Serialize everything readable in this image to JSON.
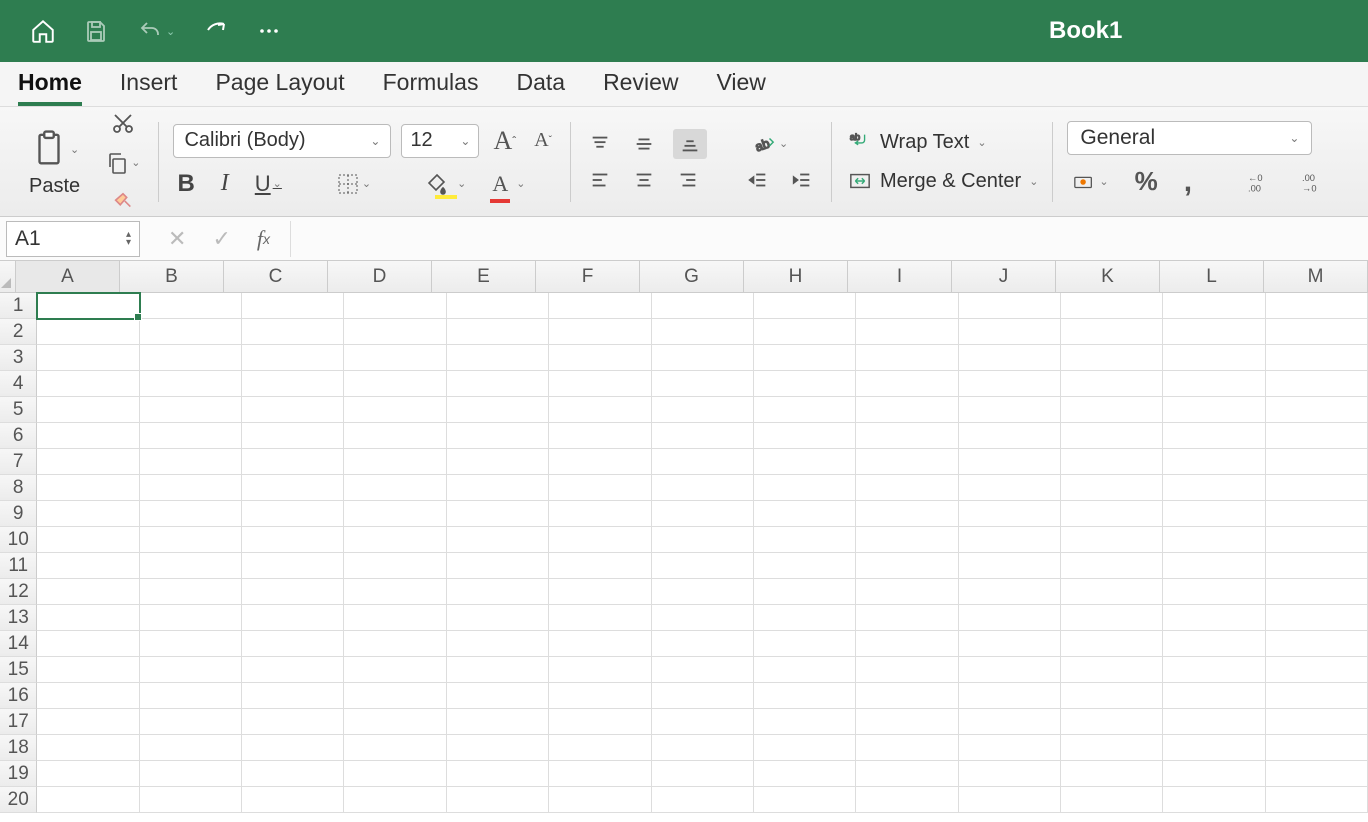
{
  "title": "Book1",
  "tabs": [
    "Home",
    "Insert",
    "Page Layout",
    "Formulas",
    "Data",
    "Review",
    "View"
  ],
  "active_tab": 0,
  "font": {
    "name": "Calibri (Body)",
    "size": "12"
  },
  "paste_label": "Paste",
  "wrap_label": "Wrap Text",
  "merge_label": "Merge & Center",
  "number_format": "General",
  "name_box": "A1",
  "formula_value": "",
  "columns": [
    "A",
    "B",
    "C",
    "D",
    "E",
    "F",
    "G",
    "H",
    "I",
    "J",
    "K",
    "L",
    "M"
  ],
  "rows": [
    "1",
    "2",
    "3",
    "4",
    "5",
    "6",
    "7",
    "8",
    "9",
    "10",
    "11",
    "12",
    "13",
    "14",
    "15",
    "16",
    "17",
    "18",
    "19",
    "20"
  ],
  "selected_cell": {
    "row": 0,
    "col": 0
  }
}
